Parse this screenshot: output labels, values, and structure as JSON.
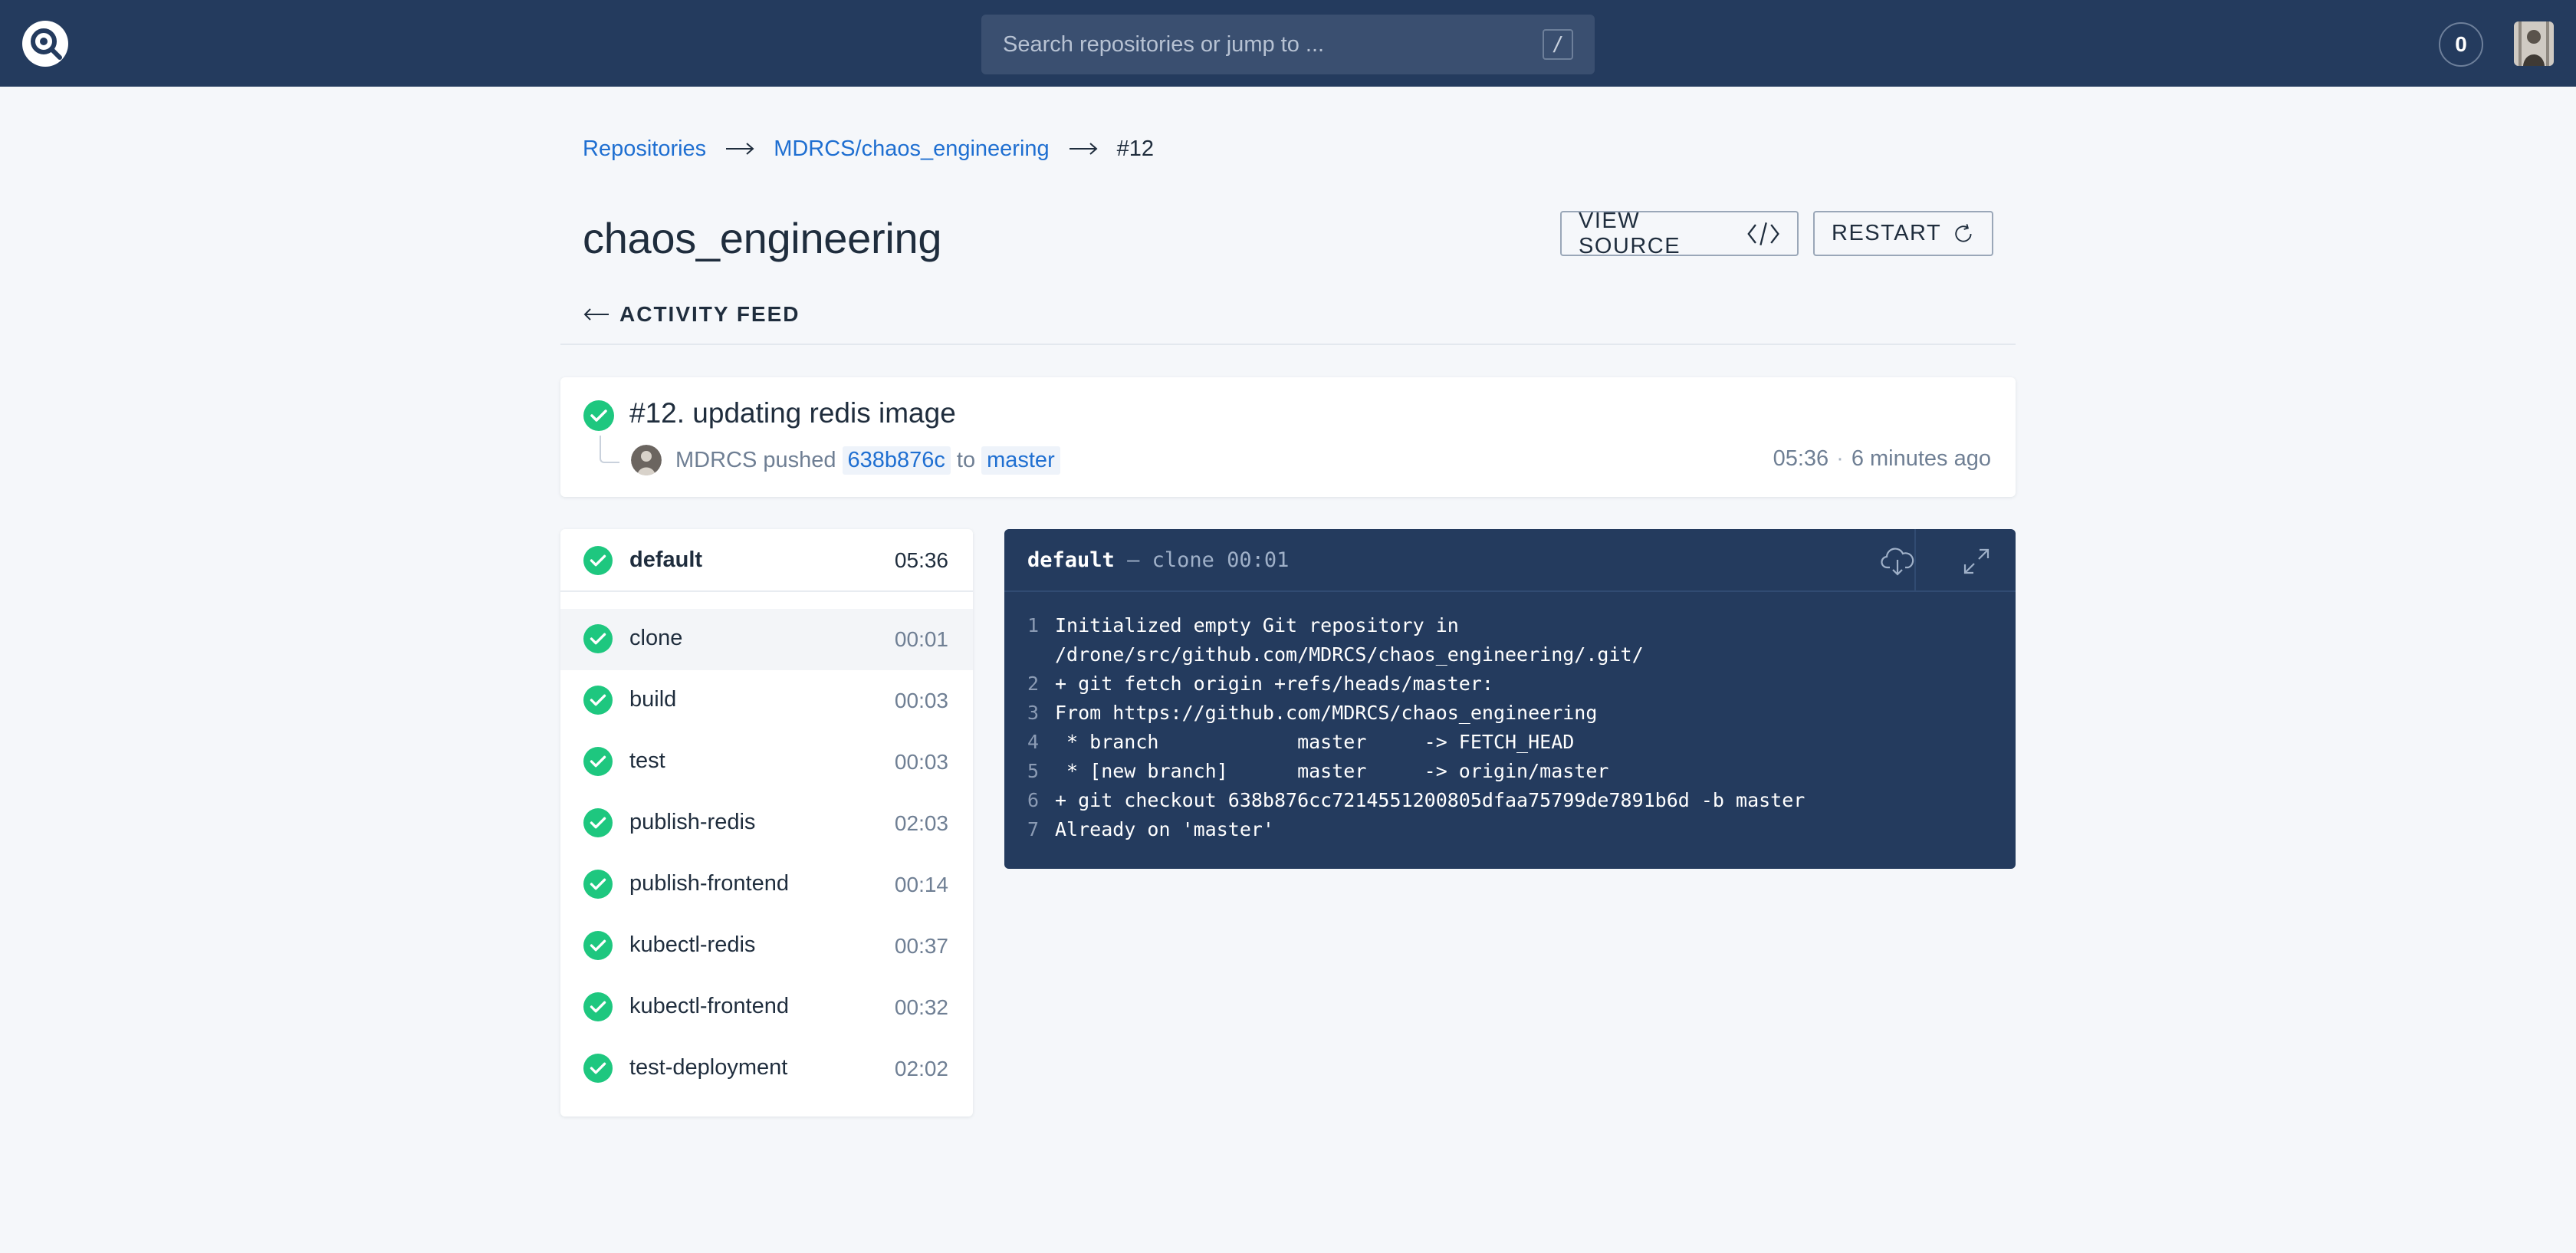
{
  "search": {
    "placeholder": "Search repositories or jump to ...",
    "shortcut": "/"
  },
  "header": {
    "notification_count": "0"
  },
  "breadcrumb": {
    "items": [
      "Repositories",
      "MDRCS/chaos_engineering"
    ],
    "current": "#12"
  },
  "page": {
    "title": "chaos_engineering",
    "view_source_label": "VIEW SOURCE",
    "restart_label": "RESTART",
    "back_label": "ACTIVITY FEED"
  },
  "build": {
    "title": "#12. updating redis image",
    "author": "MDRCS",
    "action": "pushed",
    "commit": "638b876c",
    "to_word": "to",
    "branch": "master",
    "time": "05:36",
    "age": "6 minutes ago"
  },
  "stage": {
    "name": "default",
    "duration": "05:36"
  },
  "steps": [
    {
      "name": "clone",
      "duration": "00:01"
    },
    {
      "name": "build",
      "duration": "00:03"
    },
    {
      "name": "test",
      "duration": "00:03"
    },
    {
      "name": "publish-redis",
      "duration": "02:03"
    },
    {
      "name": "publish-frontend",
      "duration": "00:14"
    },
    {
      "name": "kubectl-redis",
      "duration": "00:37"
    },
    {
      "name": "kubectl-frontend",
      "duration": "00:32"
    },
    {
      "name": "test-deployment",
      "duration": "02:02"
    }
  ],
  "log": {
    "stage": "default",
    "separator": "—",
    "step": "clone",
    "duration": "00:01",
    "lines": [
      {
        "n": "1",
        "text": "Initialized empty Git repository in"
      },
      {
        "n": "",
        "text": "/drone/src/github.com/MDRCS/chaos_engineering/.git/"
      },
      {
        "n": "2",
        "text": "+ git fetch origin +refs/heads/master:"
      },
      {
        "n": "3",
        "text": "From https://github.com/MDRCS/chaos_engineering"
      },
      {
        "n": "4",
        "text": " * branch            master     -> FETCH_HEAD"
      },
      {
        "n": "5",
        "text": " * [new branch]      master     -> origin/master"
      },
      {
        "n": "6",
        "text": "+ git checkout 638b876cc7214551200805dfaa75799de7891b6d -b master"
      },
      {
        "n": "7",
        "text": "Already on 'master'"
      }
    ]
  },
  "colors": {
    "topbar": "#243b5e",
    "success": "#1ec77f",
    "link": "#1f6fd1",
    "log_bg": "#243b5e"
  },
  "icons": {
    "logo": "drone-logo-icon",
    "download": "cloud-download-icon",
    "expand": "expand-icon",
    "view_source": "code-icon",
    "restart": "refresh-icon",
    "back": "arrow-left-icon",
    "status": "check-circle-icon"
  }
}
